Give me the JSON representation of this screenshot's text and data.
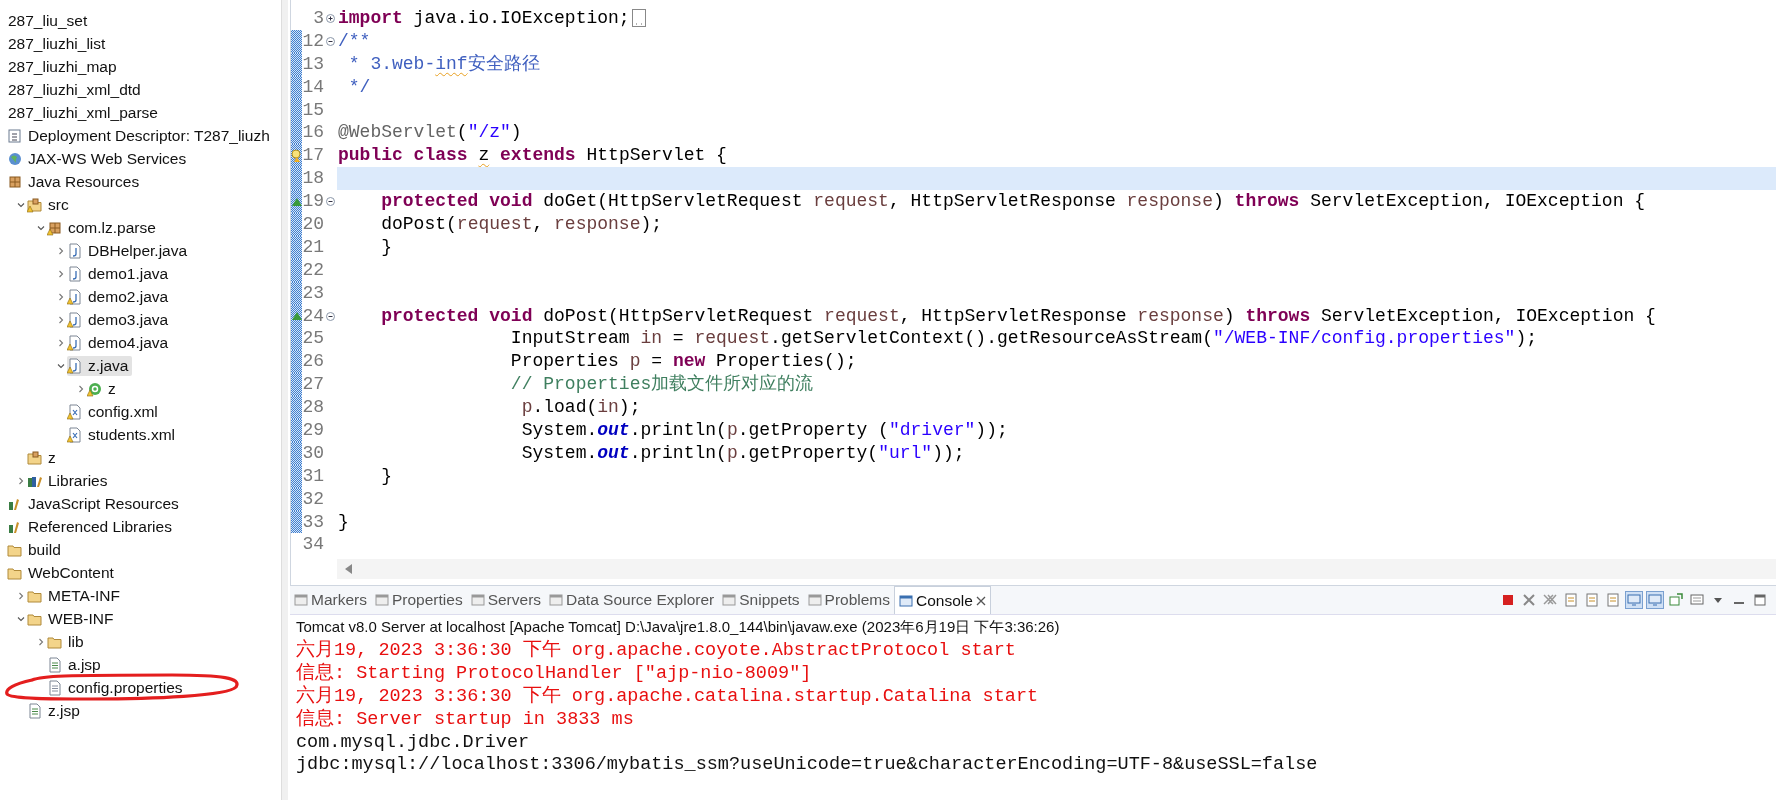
{
  "project_tree": [
    {
      "label": "287_liu_set",
      "selected": false
    },
    {
      "label": "287_liuzhi_list",
      "selected": false
    },
    {
      "label": "287_liuzhi_map",
      "selected": false
    },
    {
      "label": "287_liuzhi_xml_dtd",
      "selected": false
    },
    {
      "label": "287_liuzhi_xml_parse",
      "selected": false,
      "children": [
        {
          "label": "Deployment Descriptor: T287_liuzh",
          "kind": "descriptor",
          "selected": false,
          "warning": false
        },
        {
          "label": "JAX-WS Web Services",
          "kind": "webservices",
          "selected": false,
          "warning": false
        },
        {
          "label": "Java Resources",
          "kind": "javares",
          "selected": false,
          "warning": false,
          "children": [
            {
              "label": "src",
              "kind": "srcfolder",
              "selected": false,
              "warning": true,
              "expanded": true,
              "children": [
                {
                  "label": "com.lz.parse",
                  "kind": "package",
                  "selected": false,
                  "warning": true,
                  "expanded": true,
                  "children": [
                    {
                      "label": "DBHelper.java",
                      "kind": "java",
                      "selected": false,
                      "warning": false,
                      "expanded": false
                    },
                    {
                      "label": "demo1.java",
                      "kind": "java",
                      "selected": false,
                      "warning": false,
                      "expanded": false
                    },
                    {
                      "label": "demo2.java",
                      "kind": "java",
                      "selected": false,
                      "warning": true,
                      "expanded": false
                    },
                    {
                      "label": "demo3.java",
                      "kind": "java",
                      "selected": false,
                      "warning": true,
                      "expanded": false
                    },
                    {
                      "label": "demo4.java",
                      "kind": "java",
                      "selected": false,
                      "warning": true,
                      "expanded": false
                    },
                    {
                      "label": "z.java",
                      "kind": "java",
                      "selected": true,
                      "warning": true,
                      "expanded": true,
                      "children": [
                        {
                          "label": "z",
                          "kind": "class",
                          "selected": false,
                          "warning": true,
                          "expanded": false
                        }
                      ]
                    },
                    {
                      "label": "config.xml",
                      "kind": "xml",
                      "selected": false,
                      "warning": true
                    },
                    {
                      "label": "students.xml",
                      "kind": "xml",
                      "selected": false,
                      "warning": true
                    }
                  ]
                }
              ]
            },
            {
              "label": "z",
              "kind": "pkgfolder",
              "selected": false,
              "warning": false
            },
            {
              "label": "Libraries",
              "kind": "libraries",
              "selected": false,
              "warning": false,
              "expanded": false
            }
          ]
        },
        {
          "label": "JavaScript Resources",
          "kind": "jsres",
          "selected": false,
          "warning": false
        },
        {
          "label": "Referenced Libraries",
          "kind": "jsres",
          "selected": false,
          "warning": false
        },
        {
          "label": "build",
          "kind": "folder",
          "selected": false,
          "warning": false
        },
        {
          "label": "WebContent",
          "kind": "folder",
          "selected": false,
          "warning": false,
          "children": [
            {
              "label": "META-INF",
              "kind": "folder",
              "selected": false,
              "warning": false,
              "expanded": false
            },
            {
              "label": "WEB-INF",
              "kind": "folder",
              "selected": false,
              "warning": false,
              "expanded": true,
              "children": [
                {
                  "label": "lib",
                  "kind": "folder",
                  "selected": false,
                  "warning": false,
                  "expanded": false
                },
                {
                  "label": "a.jsp",
                  "kind": "jsp",
                  "selected": false,
                  "warning": false
                },
                {
                  "label": "config.properties",
                  "kind": "text",
                  "selected": false,
                  "warning": false
                }
              ]
            },
            {
              "label": "z.jsp",
              "kind": "jsp",
              "selected": false,
              "warning": false
            }
          ]
        }
      ]
    }
  ],
  "editor": {
    "lines": [
      {
        "number": "3",
        "collapsed": true,
        "changed": false,
        "current": false,
        "segments": [
          {
            "kind": "keyword",
            "text": "import"
          },
          {
            "kind": "plain",
            "text": " java.io.IOException;"
          }
        ]
      },
      {
        "number": "12",
        "collapsed": false,
        "changed": true,
        "current": false,
        "segments": [
          {
            "kind": "javadoc",
            "text": "/**"
          }
        ]
      },
      {
        "number": "13",
        "changed": true,
        "current": false,
        "segments": [
          {
            "kind": "javadoc",
            "text": " * 3.web-"
          },
          {
            "kind": "javadoc",
            "text": "inf",
            "squiggle": true
          },
          {
            "kind": "javadoc",
            "text": "安全路径"
          }
        ]
      },
      {
        "number": "14",
        "changed": true,
        "current": false,
        "segments": [
          {
            "kind": "javadoc",
            "text": " */"
          }
        ]
      },
      {
        "number": "15",
        "changed": true,
        "current": false
      },
      {
        "number": "16",
        "changed": true,
        "current": false,
        "segments": [
          {
            "kind": "annotation",
            "text": "@WebServlet"
          },
          {
            "kind": "plain",
            "text": "("
          },
          {
            "kind": "string",
            "text": "\"/z\""
          },
          {
            "kind": "plain",
            "text": ")"
          }
        ]
      },
      {
        "number": "17",
        "warning": true,
        "changed": true,
        "current": false,
        "segments": [
          {
            "kind": "keyword",
            "text": "public class "
          },
          {
            "kind": "plain",
            "text": "z",
            "squiggle": true
          },
          {
            "kind": "keyword",
            "text": " extends"
          },
          {
            "kind": "plain",
            "text": " HttpServlet {"
          }
        ]
      },
      {
        "number": "18",
        "changed": true,
        "current": true
      },
      {
        "number": "19",
        "collapsed": false,
        "override": true,
        "changed": true,
        "current": false,
        "segments": [
          {
            "kind": "keyword",
            "text": "    protected void"
          },
          {
            "kind": "plain",
            "text": " doGet(HttpServletRequest "
          },
          {
            "kind": "param",
            "text": "request"
          },
          {
            "kind": "plain",
            "text": ", HttpServletResponse "
          },
          {
            "kind": "param",
            "text": "response"
          },
          {
            "kind": "plain",
            "text": ") "
          },
          {
            "kind": "keyword",
            "text": "throws"
          },
          {
            "kind": "plain",
            "text": " ServletException, IOException {"
          }
        ]
      },
      {
        "number": "20",
        "changed": true,
        "current": false,
        "segments": [
          {
            "kind": "plain",
            "text": "    doPost("
          },
          {
            "kind": "param",
            "text": "request"
          },
          {
            "kind": "plain",
            "text": ", "
          },
          {
            "kind": "param",
            "text": "response"
          },
          {
            "kind": "plain",
            "text": ");"
          }
        ]
      },
      {
        "number": "21",
        "changed": true,
        "current": false,
        "segments": [
          {
            "kind": "plain",
            "text": "    }"
          }
        ]
      },
      {
        "number": "22",
        "changed": true,
        "current": false
      },
      {
        "number": "23",
        "changed": true,
        "current": false
      },
      {
        "number": "24",
        "collapsed": false,
        "override": true,
        "changed": true,
        "current": false,
        "segments": [
          {
            "kind": "keyword",
            "text": "    protected void"
          },
          {
            "kind": "plain",
            "text": " doPost(HttpServletRequest "
          },
          {
            "kind": "param",
            "text": "request"
          },
          {
            "kind": "plain",
            "text": ", HttpServletResponse "
          },
          {
            "kind": "param",
            "text": "response"
          },
          {
            "kind": "plain",
            "text": ") "
          },
          {
            "kind": "keyword",
            "text": "throws"
          },
          {
            "kind": "plain",
            "text": " ServletException, IOException {"
          }
        ]
      },
      {
        "number": "25",
        "changed": true,
        "current": false,
        "segments": [
          {
            "kind": "plain",
            "text": "                InputStream "
          },
          {
            "kind": "param",
            "text": "in"
          },
          {
            "kind": "plain",
            "text": " = "
          },
          {
            "kind": "param",
            "text": "request"
          },
          {
            "kind": "plain",
            "text": ".getServletContext().getResourceAsStream("
          },
          {
            "kind": "string",
            "text": "\"/WEB-INF/config.properties\""
          },
          {
            "kind": "plain",
            "text": ");"
          }
        ]
      },
      {
        "number": "26",
        "changed": true,
        "current": false,
        "segments": [
          {
            "kind": "plain",
            "text": "                Properties "
          },
          {
            "kind": "param",
            "text": "p"
          },
          {
            "kind": "plain",
            "text": " = "
          },
          {
            "kind": "keyword",
            "text": "new"
          },
          {
            "kind": "plain",
            "text": " Properties();"
          }
        ]
      },
      {
        "number": "27",
        "changed": true,
        "current": false,
        "segments": [
          {
            "kind": "comment",
            "text": "                // Properties加载文件所对应的流"
          }
        ]
      },
      {
        "number": "28",
        "changed": true,
        "current": false,
        "segments": [
          {
            "kind": "param",
            "text": "                 p"
          },
          {
            "kind": "plain",
            "text": ".load("
          },
          {
            "kind": "param",
            "text": "in"
          },
          {
            "kind": "plain",
            "text": ");"
          }
        ]
      },
      {
        "number": "29",
        "changed": true,
        "current": false,
        "segments": [
          {
            "kind": "plain",
            "text": "                 System."
          },
          {
            "kind": "field",
            "text": "out"
          },
          {
            "kind": "plain",
            "text": ".println("
          },
          {
            "kind": "param",
            "text": "p"
          },
          {
            "kind": "plain",
            "text": ".getProperty ("
          },
          {
            "kind": "string",
            "text": "\"driver\""
          },
          {
            "kind": "plain",
            "text": "));"
          }
        ]
      },
      {
        "number": "30",
        "changed": true,
        "current": false,
        "segments": [
          {
            "kind": "plain",
            "text": "                 System."
          },
          {
            "kind": "field",
            "text": "out"
          },
          {
            "kind": "plain",
            "text": ".println("
          },
          {
            "kind": "param",
            "text": "p"
          },
          {
            "kind": "plain",
            "text": ".getProperty("
          },
          {
            "kind": "string",
            "text": "\"url\""
          },
          {
            "kind": "plain",
            "text": "));"
          }
        ]
      },
      {
        "number": "31",
        "changed": true,
        "current": false,
        "segments": [
          {
            "kind": "plain",
            "text": "    }"
          }
        ]
      },
      {
        "number": "32",
        "changed": true,
        "current": false
      },
      {
        "number": "33",
        "changed": true,
        "current": false,
        "segments": [
          {
            "kind": "plain",
            "text": "}"
          }
        ]
      },
      {
        "number": "34",
        "changed": false,
        "current": false
      }
    ]
  },
  "console": {
    "tabs": [
      {
        "label": "Markers",
        "selected": false
      },
      {
        "label": "Properties",
        "selected": false
      },
      {
        "label": "Servers",
        "selected": false
      },
      {
        "label": "Data Source Explorer",
        "selected": false
      },
      {
        "label": "Snippets",
        "selected": false
      },
      {
        "label": "Problems",
        "selected": false
      },
      {
        "label": "Console",
        "selected": true
      }
    ],
    "launch_info": "Tomcat v8.0 Server at localhost [Apache Tomcat] D:\\Java\\jre1.8.0_144\\bin\\javaw.exe (2023年6月19日 下午3:36:26)",
    "lines": [
      {
        "kind": "error",
        "text": "六月19, 2023 3:36:30 下午 org.apache.coyote.AbstractProtocol start"
      },
      {
        "kind": "error",
        "text": "信息: Starting ProtocolHandler [\"ajp-nio-8009\"]"
      },
      {
        "kind": "error",
        "text": "六月19, 2023 3:36:30 下午 org.apache.catalina.startup.Catalina start"
      },
      {
        "kind": "error",
        "text": "信息: Server startup in 3833 ms"
      },
      {
        "kind": "output",
        "text": "com.mysql.jdbc.Driver"
      },
      {
        "kind": "output",
        "text": "jdbc:mysql://localhost:3306/mybatis_ssm?useUnicode=true&characterEncoding=UTF-8&useSSL=false"
      }
    ]
  }
}
